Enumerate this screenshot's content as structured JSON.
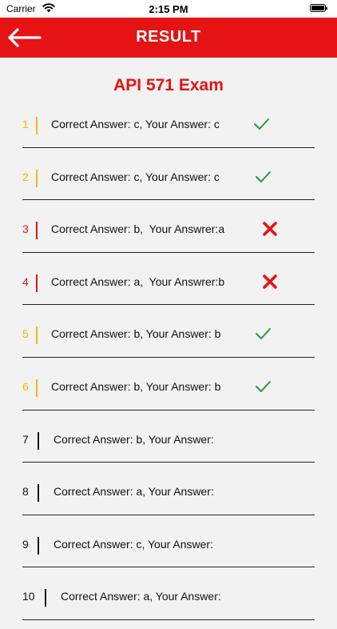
{
  "status_bar": {
    "carrier": "Carrier",
    "time": "2:15 PM"
  },
  "nav": {
    "title": "RESULT",
    "back_icon": "arrow-left-icon"
  },
  "exam": {
    "title": "API 571 Exam"
  },
  "colors": {
    "accent": "#e51313",
    "correct": "#f5b800",
    "wrong": "#e51313",
    "unanswered": "#111111",
    "check": "#1f9d3a"
  },
  "results": [
    {
      "number": "1",
      "text": "Correct Answer: c, Your Answer: c",
      "status": "correct"
    },
    {
      "number": "2",
      "text": "Correct Answer: c, Your Answer: c",
      "status": "correct"
    },
    {
      "number": "3",
      "text": "Correct Answer: b,  Your Answrer:a",
      "status": "wrong"
    },
    {
      "number": "4",
      "text": "Correct Answer: a,  Your Answrer:b",
      "status": "wrong"
    },
    {
      "number": "5",
      "text": "Correct Answer: b, Your Answer: b",
      "status": "correct"
    },
    {
      "number": "6",
      "text": "Correct Answer: b, Your Answer: b",
      "status": "correct"
    },
    {
      "number": "7",
      "text": "Correct Answer: b, Your Answer:",
      "status": "unanswered"
    },
    {
      "number": "8",
      "text": "Correct Answer: a, Your Answer:",
      "status": "unanswered"
    },
    {
      "number": "9",
      "text": "Correct Answer: c, Your Answer:",
      "status": "unanswered"
    },
    {
      "number": "10",
      "text": "Correct Answer: a, Your Answer:",
      "status": "unanswered"
    }
  ]
}
